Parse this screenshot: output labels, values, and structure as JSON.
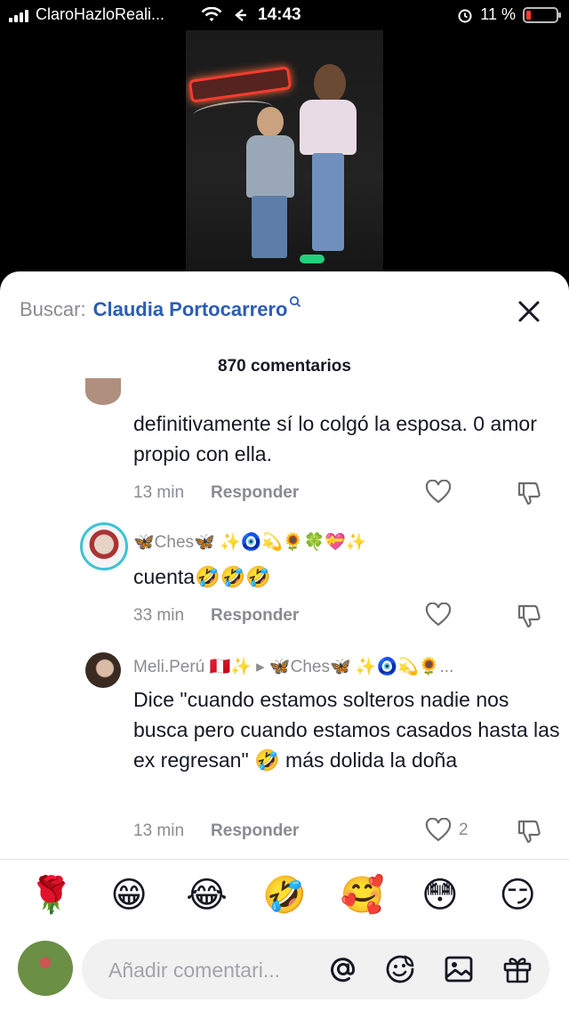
{
  "status_bar": {
    "carrier": "ClaroHazloReali...",
    "time": "14:43",
    "battery": "11 %"
  },
  "search": {
    "prefix": "Buscar:",
    "term": "Claudia Portocarrero"
  },
  "comment_count": "870 comentarios",
  "comments": [
    {
      "user": "",
      "text": "definitivamente sí lo colgó la esposa. 0 amor propio con ella.",
      "time": "13 min",
      "reply": "Responder",
      "likes": ""
    },
    {
      "user": "🦋Ches🦋 ✨🧿💫🌻🍀💝✨",
      "text": "cuenta🤣🤣🤣",
      "time": "33 min",
      "reply": "Responder",
      "likes": ""
    },
    {
      "user": "Meli.Perú 🇵🇪✨ ▸ 🦋Ches🦋 ✨🧿💫🌻...",
      "text": "Dice \"cuando estamos solteros nadie nos busca pero cuando estamos casados hasta las ex regresan\" 🤣 más dolida la doña",
      "time": "13 min",
      "reply": "Responder",
      "likes": "2"
    }
  ],
  "emoji_bar": [
    "🌹",
    "😁",
    "😂",
    "🤣",
    "🥰",
    "😳",
    "😏"
  ],
  "comment_input": {
    "placeholder": "Añadir comentari..."
  },
  "icons": {
    "signal": "signal-bars-icon",
    "wifi": "wifi-icon",
    "alarm": "alarm-icon",
    "close": "close-icon",
    "heart": "heart-icon",
    "dislike": "thumb-down-icon",
    "mention": "at-sign-icon",
    "emoji": "emoji-face-icon",
    "image": "image-icon",
    "gift": "gift-icon"
  },
  "colors": {
    "search_term": "#2b5db5",
    "battery_low": "#ff3b30",
    "avatar_ring": "#3cc3d6"
  }
}
